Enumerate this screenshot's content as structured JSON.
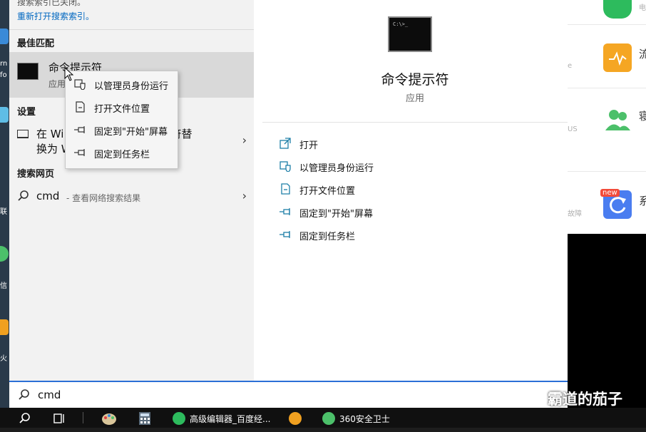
{
  "desktop_left": {
    "frag_1": "rn",
    "frag_2": "fo",
    "frag_3": "联",
    "frag_4": "信",
    "frag_5": "火"
  },
  "background_app": {
    "rows": [
      {
        "title": "",
        "sub": "电",
        "color": "#2dbb5d"
      },
      {
        "title": "流",
        "sub": "e",
        "color": "#f5a623"
      },
      {
        "title": "寝",
        "sub": "US",
        "color": "#4cc06a"
      },
      {
        "title": "系",
        "sub": "故障",
        "color": "#4a7df0",
        "badge": "new"
      }
    ]
  },
  "search_results": {
    "notice_line1": "搜索索引已关闭。",
    "notice_line2": "重新打开搜索索引。",
    "best_match_header": "最佳匹配",
    "best_match": {
      "title": "命令提示符",
      "type": "应用",
      "icon": "cmd-app-icon"
    },
    "settings_header": "设置",
    "settings_item": {
      "line1": "在 Wi",
      "line1_tail": "符替",
      "line2": "换为 W"
    },
    "web_header": "搜索网页",
    "web_item": {
      "query": "cmd",
      "suffix": "- 查看网络搜索结果"
    }
  },
  "context_menu": {
    "items": [
      {
        "label": "以管理员身份运行",
        "icon": "shield-run-icon"
      },
      {
        "label": "打开文件位置",
        "icon": "file-location-icon"
      },
      {
        "label": "固定到\"开始\"屏幕",
        "icon": "pin-icon"
      },
      {
        "label": "固定到任务栏",
        "icon": "pin-icon"
      }
    ]
  },
  "detail_pane": {
    "title": "命令提示符",
    "subtitle": "应用",
    "prompt_glyph": "C:\\>_",
    "actions": [
      {
        "label": "打开",
        "icon": "open-icon"
      },
      {
        "label": "以管理员身份运行",
        "icon": "shield-run-icon"
      },
      {
        "label": "打开文件位置",
        "icon": "file-location-icon"
      },
      {
        "label": "固定到\"开始\"屏幕",
        "icon": "pin-icon"
      },
      {
        "label": "固定到任务栏",
        "icon": "pin-icon"
      }
    ]
  },
  "search_box": {
    "value": "cmd"
  },
  "watermark": {
    "text": "霸道的茄子"
  },
  "taskbar": {
    "apps": [
      {
        "label": "高级编辑器_百度经...",
        "icon": "editor-app-icon"
      },
      {
        "label": "360安全卫士",
        "icon": "security-app-icon"
      }
    ]
  },
  "colors": {
    "accent": "#0067c0",
    "highlight": "#d9d9d9",
    "icon_teal": "#1e7fa8"
  }
}
